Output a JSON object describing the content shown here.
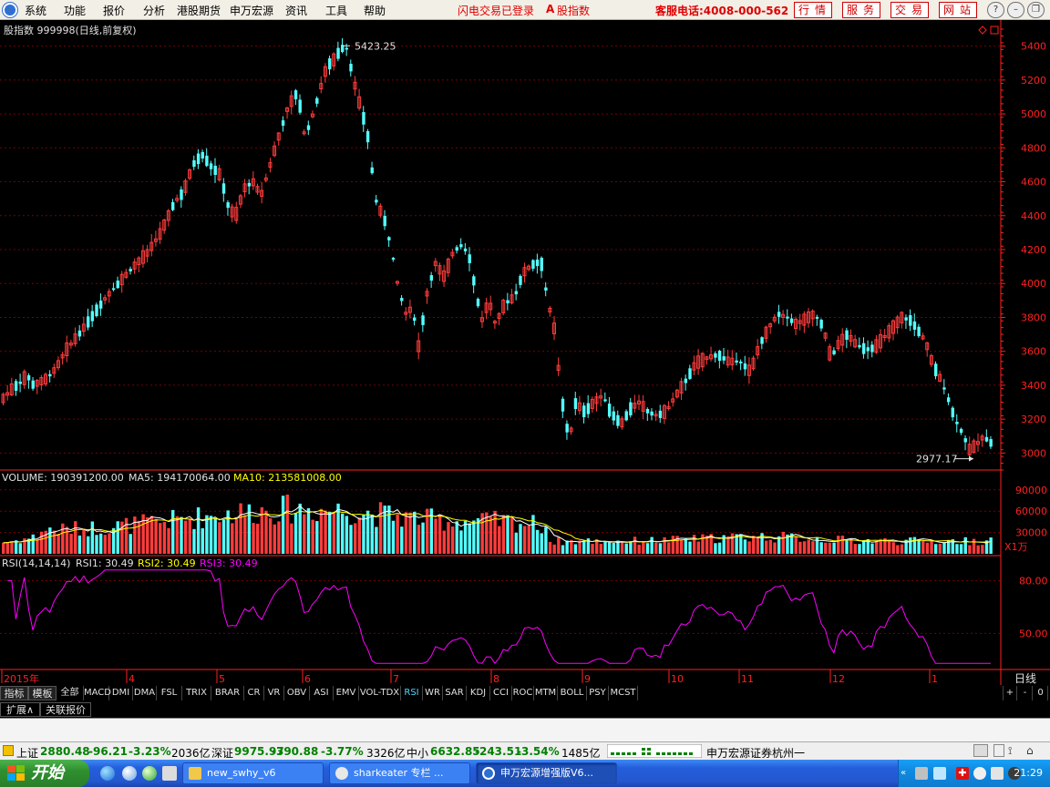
{
  "menu": {
    "items": [
      "系统",
      "功能",
      "报价",
      "分析",
      "港股期货",
      "申万宏源",
      "资讯",
      "工具",
      "帮助"
    ],
    "login_status": "闪电交易已登录",
    "index_link": "股指数",
    "hotline": "客服电话:4008-000-562",
    "service_buttons": [
      "行情",
      "服务",
      "交易",
      "网站"
    ]
  },
  "chart": {
    "title": "股指数  999998(日线,前复权)",
    "high_label": "5423.25",
    "low_label": "2977.17",
    "price_ticks": [
      "5400",
      "5200",
      "5000",
      "4800",
      "4600",
      "4400",
      "4200",
      "4000",
      "3800",
      "3600",
      "3400",
      "3200",
      "3000"
    ],
    "volume_header": {
      "volume": "VOLUME: 190391200.00",
      "ma5": "MA5: 194170064.00",
      "ma10": "MA10: 213581008.00"
    },
    "volume_ticks": [
      "90000",
      "60000",
      "30000"
    ],
    "volume_unit": "X1万",
    "rsi_header": {
      "name": "RSI(14,14,14)",
      "rsi1": "RSI1: 30.49",
      "rsi2": "RSI2: 30.49",
      "rsi3": "RSI3: 30.49"
    },
    "rsi_ticks": [
      "80.00",
      "50.00"
    ],
    "date_labels": [
      "2015年",
      "4",
      "5",
      "6",
      "7",
      "8",
      "9",
      "10",
      "11",
      "12",
      "1"
    ],
    "period_label": "日线",
    "colors": {
      "up": "#ff3c3c",
      "down": "#54ffff",
      "ma5": "#ffffff",
      "ma10": "#ffff00",
      "rsi": "#ff00ff",
      "grid": "#7a0000",
      "axis": "#ff2020"
    }
  },
  "chart_data": {
    "type": "candlestick",
    "title": "股指数  999998(日线,前复权)",
    "period": "日线",
    "x_range": [
      "2015年",
      "1"
    ],
    "price_axis": {
      "ticks": [
        3000,
        3200,
        3400,
        3600,
        3800,
        4000,
        4200,
        4400,
        4600,
        4800,
        5000,
        5200,
        5400
      ],
      "range": [
        2900,
        5500
      ]
    },
    "annotations": {
      "high": 5423.25,
      "low": 2977.17
    },
    "close_by_month": [
      {
        "month": "2015年",
        "close": 3330
      },
      {
        "month": "4",
        "close": 3750
      },
      {
        "month": "5",
        "close": 4480
      },
      {
        "month": "6",
        "close": 5180
      },
      {
        "month": "7",
        "close": 3900
      },
      {
        "month": "8",
        "close": 3900
      },
      {
        "month": "9",
        "close": 3100
      },
      {
        "month": "10",
        "close": 3380
      },
      {
        "month": "11",
        "close": 3600
      },
      {
        "month": "12",
        "close": 3630
      },
      {
        "month": "1",
        "close": 3600
      }
    ],
    "volume": {
      "unit": "X1万",
      "ticks": [
        30000,
        60000,
        90000
      ],
      "last": 190391200.0,
      "ma5": 194170064.0,
      "ma10": 213581008.0
    },
    "rsi": {
      "params": "14,14,14",
      "ticks": [
        50,
        80
      ],
      "rsi1": 30.49,
      "rsi2": 30.49,
      "rsi3": 30.49
    }
  },
  "indicator_tabs": {
    "lead": [
      "指标",
      "模板"
    ],
    "items": [
      "全部",
      "MACD",
      "DMI",
      "DMA",
      "FSL",
      "TRIX",
      "BRAR",
      "CR",
      "VR",
      "OBV",
      "ASI",
      "EMV",
      "VOL-TDX",
      "RSI",
      "WR",
      "SAR",
      "KDJ",
      "CCI",
      "ROC",
      "MTM",
      "BOLL",
      "PSY",
      "MCST"
    ],
    "active": "RSI",
    "controls": [
      "+",
      "-",
      "0"
    ]
  },
  "extension_tabs": [
    "扩展∧",
    "关联报价"
  ],
  "quotes": [
    {
      "name": "上证",
      "value": "2880.48",
      "change": "-96.21",
      "pct": "-3.23%",
      "amount": "2036亿"
    },
    {
      "name": "深证",
      "value": "9975.97",
      "change": "-390.88",
      "pct": "-3.77%",
      "amount": "3326亿"
    },
    {
      "name": "中小",
      "value": "6632.85",
      "change": "-243.51",
      "pct": "-3.54%",
      "amount": "1485亿"
    }
  ],
  "broker": "申万宏源证券杭州一",
  "taskbar": {
    "start": "开始",
    "tasks": [
      "new_swhy_v6",
      "sharkeater 专栏 ...",
      "申万宏源增强版V6..."
    ],
    "clock": "21:29"
  }
}
